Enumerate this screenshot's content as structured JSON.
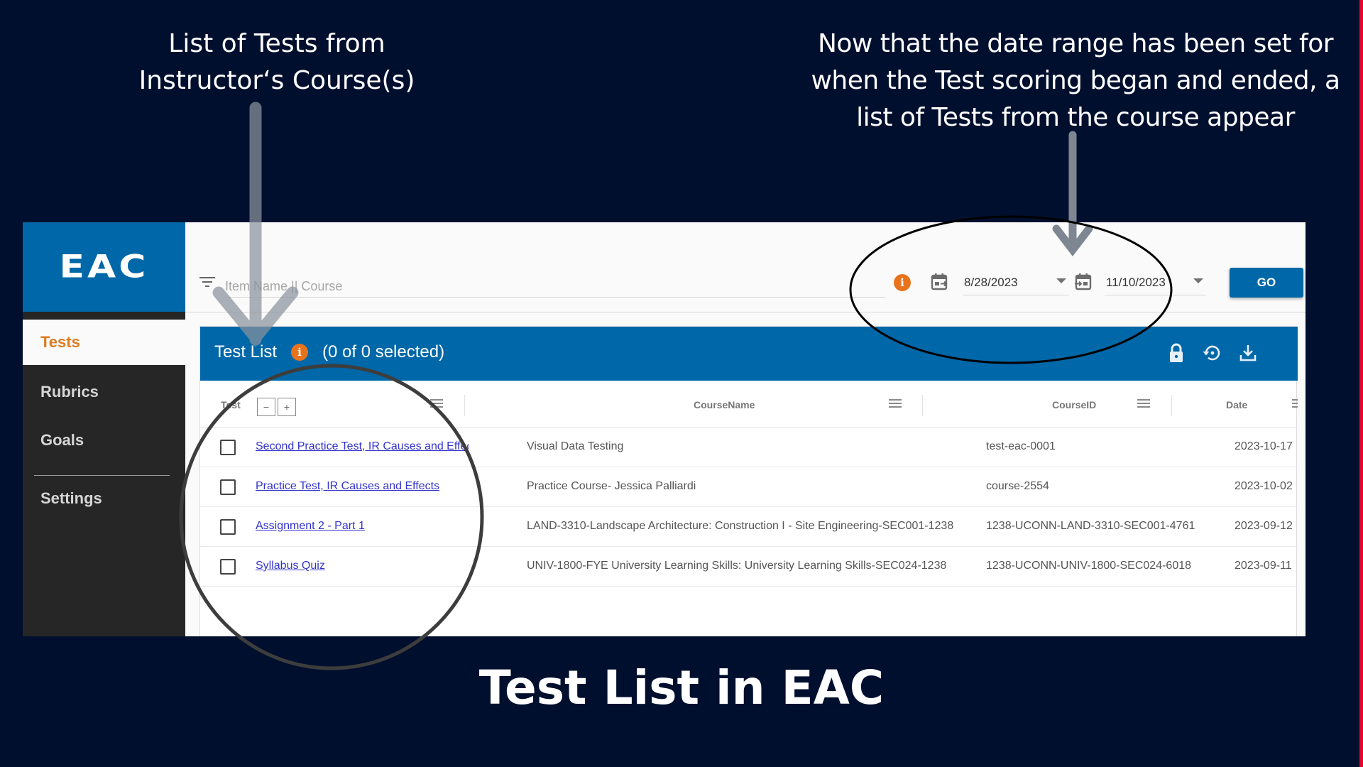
{
  "annotations": {
    "caption_left_line1": "List of Tests from",
    "caption_left_line2": "Instructor‘s Course(s)",
    "caption_right_line1": "Now that the date range has been set for",
    "caption_right_line2": "when the Test scoring began and ended, a",
    "caption_right_line3": "list of Tests from the course appear",
    "slide_title": "Test List in EAC"
  },
  "app": {
    "logo": "EAC",
    "sidebar": {
      "items": [
        {
          "label": "Tests",
          "active": true
        },
        {
          "label": "Rubrics",
          "active": false
        },
        {
          "label": "Goals",
          "active": false
        },
        {
          "label": "Settings",
          "active": false
        }
      ]
    },
    "toolbar": {
      "filter_icon": "filter-list-icon",
      "search_placeholder": "Item Name || Course",
      "search_value": "",
      "info_icon": "info-icon",
      "start_date": "8/28/2023",
      "end_date": "11/10/2023",
      "go_label": "GO"
    },
    "grid": {
      "title": "Test List",
      "selection": "(0 of 0 selected)",
      "actions": [
        "lock-icon",
        "restore-icon",
        "download-icon"
      ],
      "columns": [
        "Test",
        "CourseName",
        "CourseID",
        "Date"
      ],
      "collapse_label": "−",
      "expand_label": "+",
      "rows": [
        {
          "test": "Second Practice Test, IR Causes and Effects",
          "course_name": "Visual Data Testing",
          "course_id": "test-eac-0001",
          "date": "2023-10-17"
        },
        {
          "test": "Practice Test, IR Causes and Effects",
          "course_name": "Practice Course- Jessica Palliardi",
          "course_id": "course-2554",
          "date": "2023-10-02"
        },
        {
          "test": "Assignment 2 - Part 1",
          "course_name": "LAND-3310-Landscape Architecture: Construction I - Site Engineering-SEC001-1238",
          "course_id": "1238-UCONN-LAND-3310-SEC001-4761",
          "date": "2023-09-12"
        },
        {
          "test": "Syllabus Quiz",
          "course_name": "UNIV-1800-FYE University Learning Skills: University Learning Skills-SEC024-1238",
          "course_id": "1238-UCONN-UNIV-1800-SEC024-6018",
          "date": "2023-09-11"
        }
      ]
    }
  },
  "colors": {
    "background": "#010f2e",
    "brand_blue": "#0067a8",
    "accent_orange": "#e07a1f",
    "link": "#3333cc",
    "sidebar": "#262626"
  }
}
